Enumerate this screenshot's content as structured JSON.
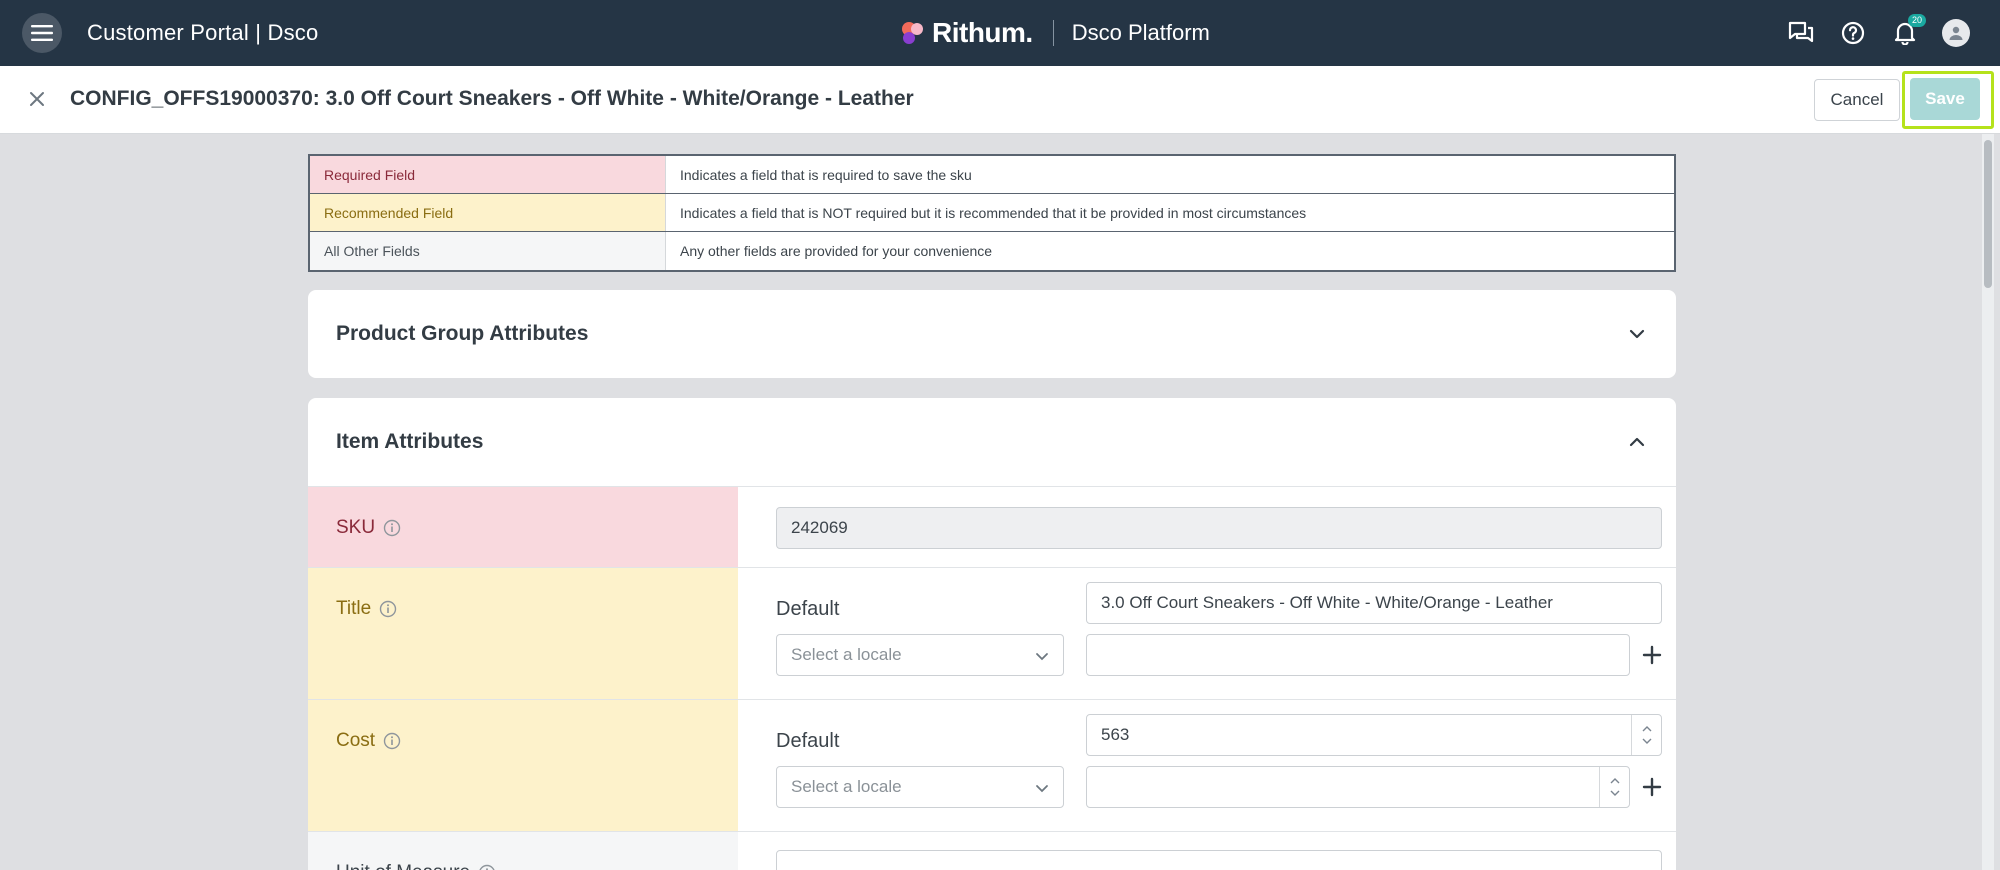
{
  "topbar": {
    "app_title": "Customer Portal | Dsco",
    "brand_name": "Rithum.",
    "platform_name": "Dsco Platform",
    "notification_count": "20",
    "colors": {
      "bar": "#253545",
      "accent": "#1aa9a0"
    }
  },
  "header": {
    "title": "CONFIG_OFFS19000370: 3.0 Off Court Sneakers - Off White - White/Orange - Leather",
    "cancel_label": "Cancel",
    "save_label": "Save"
  },
  "legend": {
    "rows": [
      {
        "key": "Required Field",
        "desc": "Indicates a field that is required to save the sku"
      },
      {
        "key": "Recommended Field",
        "desc": "Indicates a field that is NOT required but it is recommended that it be provided in most circumstances"
      },
      {
        "key": "All Other Fields",
        "desc": "Any other fields are provided for your convenience"
      }
    ]
  },
  "sections": {
    "product_group": {
      "title": "Product Group Attributes",
      "expanded": false
    },
    "item": {
      "title": "Item Attributes",
      "expanded": true,
      "fields": {
        "sku": {
          "label": "SKU",
          "value": "242069"
        },
        "title": {
          "label": "Title",
          "default_label": "Default",
          "default_value": "3.0 Off Court Sneakers - Off White - White/Orange - Leather",
          "locale_placeholder": "Select a locale",
          "locale_value": ""
        },
        "cost": {
          "label": "Cost",
          "default_label": "Default",
          "default_value": "563",
          "locale_placeholder": "Select a locale",
          "locale_value": ""
        },
        "unit_of_measure": {
          "label": "Unit of Measure"
        }
      }
    }
  }
}
